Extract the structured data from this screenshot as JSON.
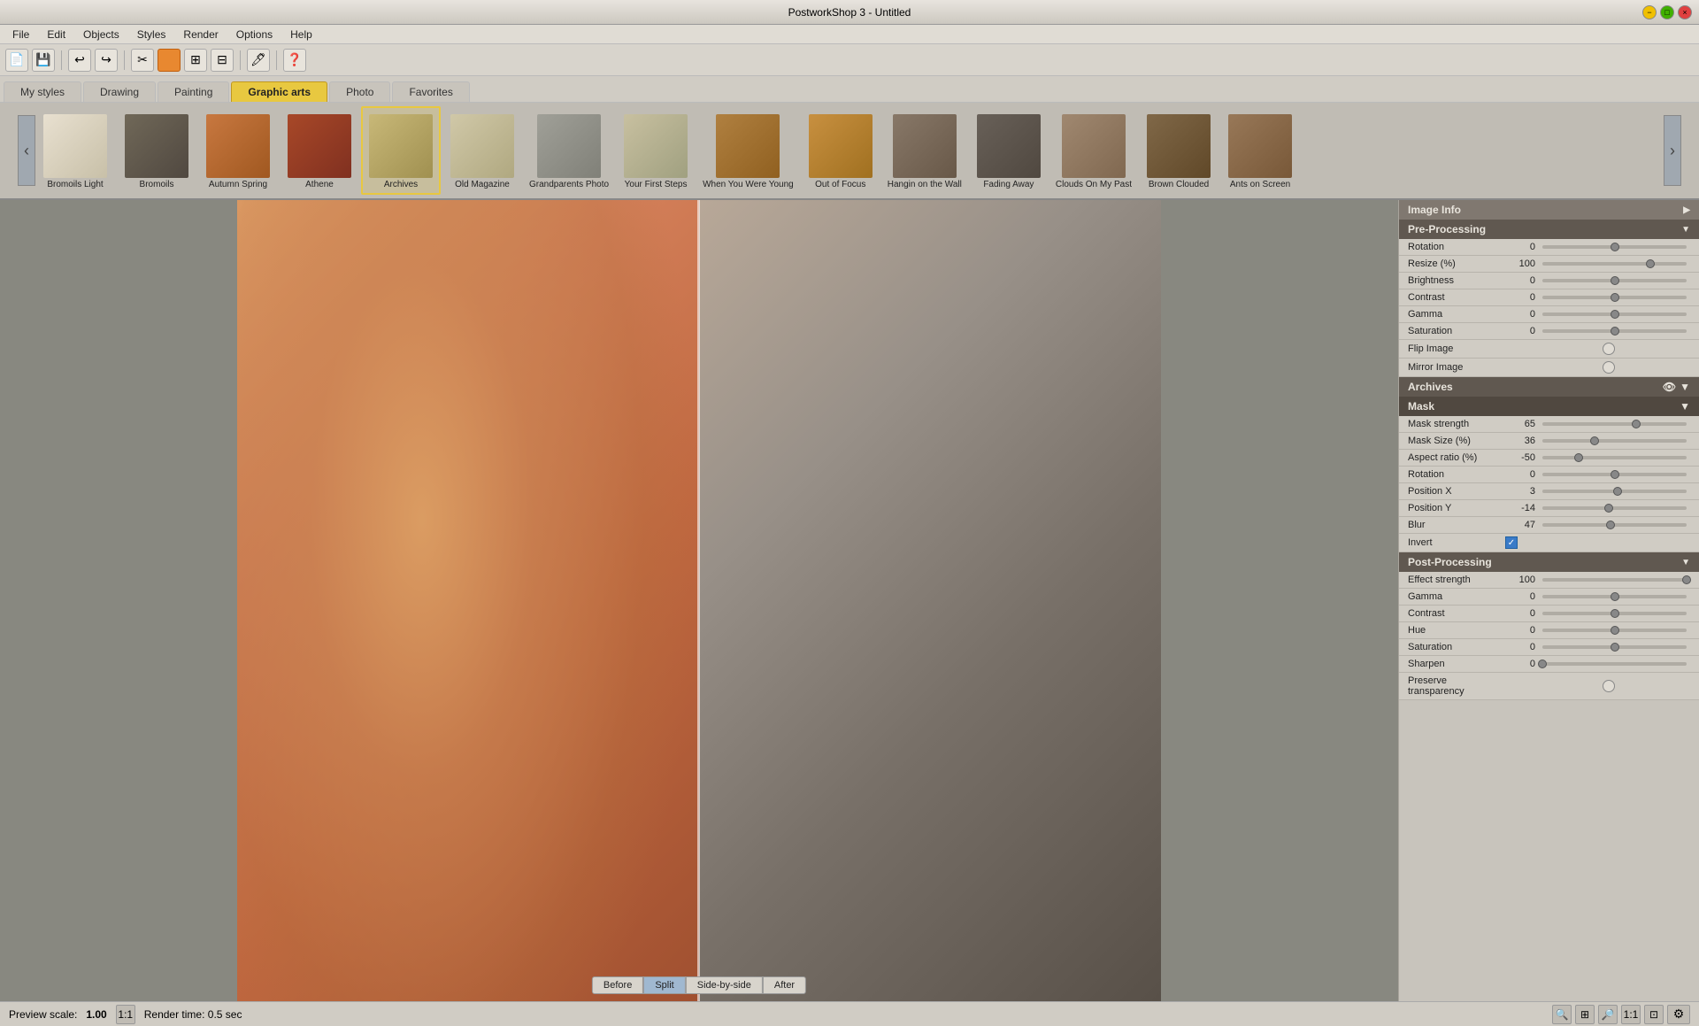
{
  "titlebar": {
    "title": "PostworkShop 3 - Untitled",
    "min": "−",
    "max": "□",
    "close": "×"
  },
  "menu": {
    "items": [
      "File",
      "Edit",
      "Objects",
      "Styles",
      "Render",
      "Options",
      "Help"
    ]
  },
  "toolbar": {
    "buttons": [
      "📄",
      "💾",
      "↩",
      "↪",
      "✂",
      "🔲",
      "🖊",
      "❓"
    ]
  },
  "style_tabs": {
    "tabs": [
      {
        "label": "My styles",
        "active": false
      },
      {
        "label": "Drawing",
        "active": false
      },
      {
        "label": "Painting",
        "active": false
      },
      {
        "label": "Graphic arts",
        "active": false
      },
      {
        "label": "Photo",
        "active": false
      },
      {
        "label": "Favorites",
        "active": false
      }
    ],
    "active_index": 3
  },
  "filters": [
    {
      "label": "Bromoils Light",
      "class": "ft-bromoils-light"
    },
    {
      "label": "Bromoils",
      "class": "ft-bromoils"
    },
    {
      "label": "Autumn Spring",
      "class": "ft-autumn"
    },
    {
      "label": "Athene",
      "class": "ft-athene"
    },
    {
      "label": "Archives",
      "class": "ft-archives",
      "selected": true
    },
    {
      "label": "Old Magazine",
      "class": "ft-old-mag"
    },
    {
      "label": "Grandparents Photo",
      "class": "ft-grandparents"
    },
    {
      "label": "Your First Steps",
      "class": "ft-first-steps"
    },
    {
      "label": "When You Were Young",
      "class": "ft-when-young"
    },
    {
      "label": "Out of Focus",
      "class": "ft-out-focus"
    },
    {
      "label": "Hangin on the Wall",
      "class": "ft-hangin"
    },
    {
      "label": "Fading Away",
      "class": "ft-fading"
    },
    {
      "label": "Clouds On My Past",
      "class": "ft-clouds"
    },
    {
      "label": "Brown Clouded",
      "class": "ft-brown-cloud"
    },
    {
      "label": "Ants on Screen",
      "class": "ft-ants"
    }
  ],
  "right_panel": {
    "image_info": {
      "header": "Image Info",
      "arrow": "▶"
    },
    "pre_processing": {
      "header": "Pre-Processing",
      "arrow": "▼",
      "rows": [
        {
          "label": "Rotation",
          "value": "0",
          "thumb_pct": 50
        },
        {
          "label": "Resize (%)",
          "value": "100",
          "thumb_pct": 75
        },
        {
          "label": "Brightness",
          "value": "0",
          "thumb_pct": 50
        },
        {
          "label": "Contrast",
          "value": "0",
          "thumb_pct": 50
        },
        {
          "label": "Gamma",
          "value": "0",
          "thumb_pct": 50
        },
        {
          "label": "Saturation",
          "value": "0",
          "thumb_pct": 50
        }
      ],
      "flip_image": {
        "label": "Flip Image",
        "checked": false
      },
      "mirror_image": {
        "label": "Mirror Image",
        "checked": false
      }
    },
    "archives": {
      "header": "Archives",
      "eye_icon": "👁",
      "arrow": "▼"
    },
    "mask": {
      "header": "Mask",
      "arrow": "▼",
      "rows": [
        {
          "label": "Mask strength",
          "value": "65",
          "thumb_pct": 65
        },
        {
          "label": "Mask Size (%)",
          "value": "36",
          "thumb_pct": 36
        },
        {
          "label": "Aspect ratio (%)",
          "value": "-50",
          "thumb_pct": 25
        },
        {
          "label": "Rotation",
          "value": "0",
          "thumb_pct": 50
        },
        {
          "label": "Position X",
          "value": "3",
          "thumb_pct": 52
        },
        {
          "label": "Position Y",
          "value": "-14",
          "thumb_pct": 46
        },
        {
          "label": "Blur",
          "value": "47",
          "thumb_pct": 47
        }
      ],
      "invert": {
        "label": "Invert",
        "checked": true
      }
    },
    "post_processing": {
      "header": "Post-Processing",
      "arrow": "▼",
      "rows": [
        {
          "label": "Effect strength",
          "value": "100",
          "thumb_pct": 100
        },
        {
          "label": "Gamma",
          "value": "0",
          "thumb_pct": 50
        },
        {
          "label": "Contrast",
          "value": "0",
          "thumb_pct": 50
        },
        {
          "label": "Hue",
          "value": "0",
          "thumb_pct": 50
        },
        {
          "label": "Saturation",
          "value": "0",
          "thumb_pct": 50
        },
        {
          "label": "Sharpen",
          "value": "0",
          "thumb_pct": 0
        }
      ],
      "preserve": {
        "label": "Preserve transparency",
        "checked": false
      }
    }
  },
  "preview": {
    "buttons": [
      "Before",
      "Split",
      "Side-by-side",
      "After"
    ],
    "active": "Split"
  },
  "statusbar": {
    "preview_scale_label": "Preview scale:",
    "preview_scale_value": "1.00",
    "one_to_one": "1:1",
    "render_time": "Render time: 0.5 sec"
  }
}
